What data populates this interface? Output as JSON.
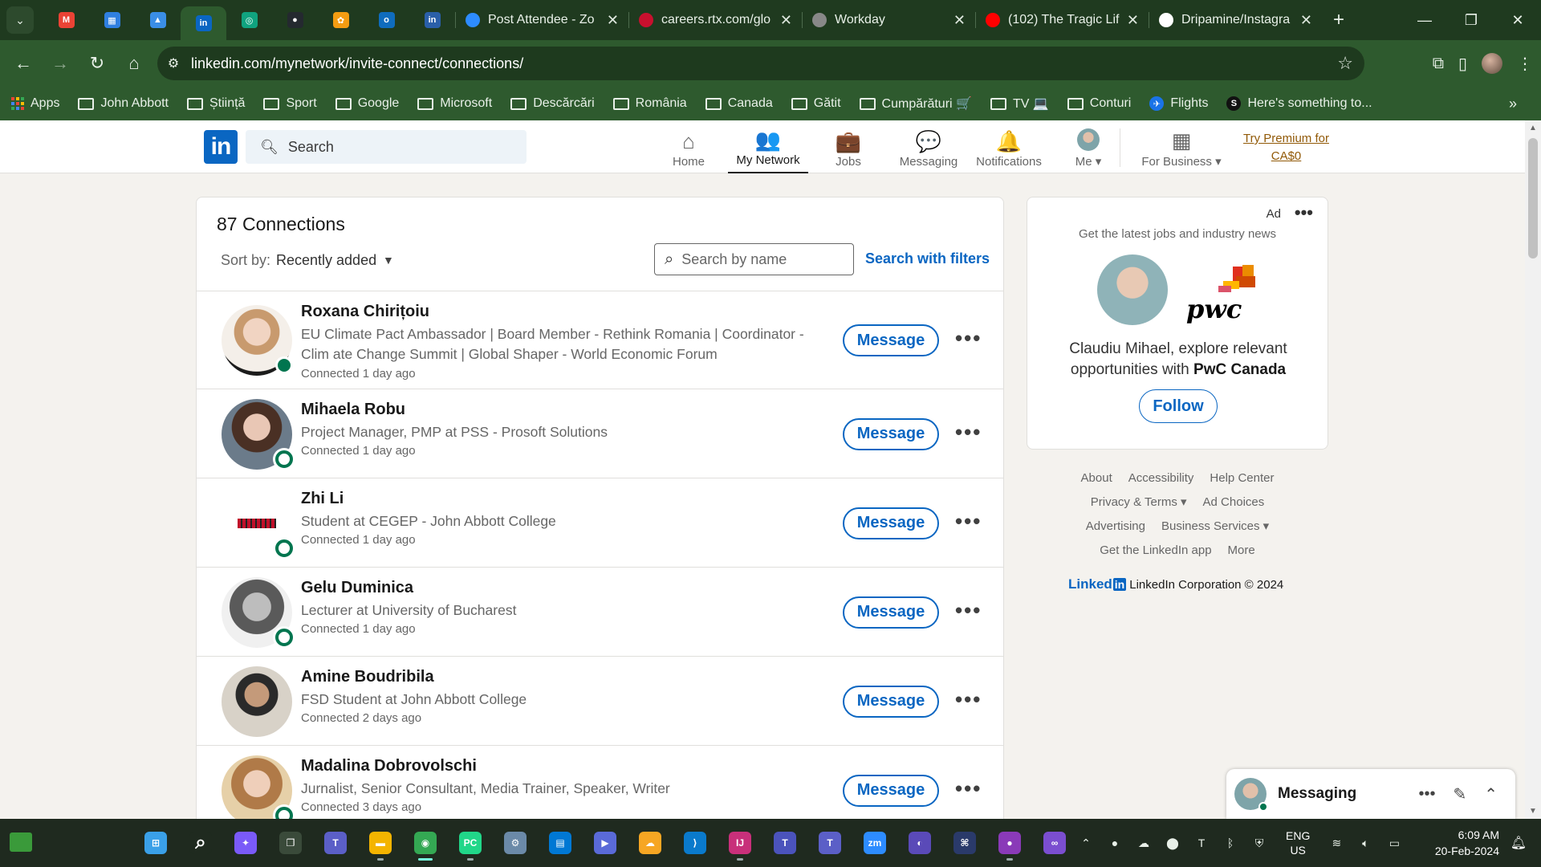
{
  "browser": {
    "tabs": [
      {
        "title": "Post Attendee - Zo",
        "icon": "zoom-icon",
        "color": "#2d8cff"
      },
      {
        "title": "careers.rtx.com/glo",
        "icon": "rtx-icon",
        "color": "#c8102e"
      },
      {
        "title": "Workday",
        "icon": "workday-icon",
        "color": "#888888"
      },
      {
        "title": "(102) The Tragic Lif",
        "icon": "youtube-icon",
        "color": "#ff0000"
      },
      {
        "title": "Dripamine/Instagra",
        "icon": "github-icon",
        "color": "#ffffff"
      }
    ],
    "pinned_tabs": [
      {
        "icon": "gmail-icon",
        "color": "#ea4335",
        "glyph": "M"
      },
      {
        "icon": "windows-icon",
        "color": "#2f7fe0",
        "glyph": "▦"
      },
      {
        "icon": "azure-icon",
        "color": "#3a8ee6",
        "glyph": "▲"
      },
      {
        "icon": "linkedin-icon",
        "color": "#0a66c2",
        "glyph": "in"
      },
      {
        "icon": "chatgpt-icon",
        "color": "#10a37f",
        "glyph": "◎"
      },
      {
        "icon": "github-icon",
        "color": "#24292f",
        "glyph": "●"
      },
      {
        "icon": "gear-orange-icon",
        "color": "#f39c12",
        "glyph": "✿"
      },
      {
        "icon": "outlook-icon",
        "color": "#0f6cbd",
        "glyph": "o"
      },
      {
        "icon": "indeed-icon",
        "color": "#2a5fa8",
        "glyph": "in"
      }
    ],
    "url": "linkedin.com/mynetwork/invite-connect/connections/",
    "bookmarks": [
      {
        "label": "Apps",
        "type": "apps"
      },
      {
        "label": "John Abbott",
        "type": "folder"
      },
      {
        "label": "Știință",
        "type": "folder"
      },
      {
        "label": "Sport",
        "type": "folder"
      },
      {
        "label": "Google",
        "type": "folder"
      },
      {
        "label": "Microsoft",
        "type": "folder"
      },
      {
        "label": "Descărcări",
        "type": "folder"
      },
      {
        "label": "România",
        "type": "folder"
      },
      {
        "label": "Canada",
        "type": "folder"
      },
      {
        "label": "Gătit",
        "type": "folder"
      },
      {
        "label": "Cumpărături 🛒",
        "type": "folder"
      },
      {
        "label": "TV 💻",
        "type": "folder"
      },
      {
        "label": "Conturi",
        "type": "folder"
      },
      {
        "label": "Flights",
        "type": "link"
      },
      {
        "label": "Here's something to...",
        "type": "link"
      }
    ]
  },
  "linkedin": {
    "search_placeholder": "Search",
    "nav": [
      {
        "label": "Home",
        "icon": "home-icon",
        "active": false
      },
      {
        "label": "My Network",
        "icon": "people-icon",
        "active": true
      },
      {
        "label": "Jobs",
        "icon": "briefcase-icon",
        "active": false
      },
      {
        "label": "Messaging",
        "icon": "chat-icon",
        "active": false
      },
      {
        "label": "Notifications",
        "icon": "bell-icon",
        "active": false
      },
      {
        "label": "Me ▾",
        "icon": "avatar",
        "active": false
      },
      {
        "label": "For Business ▾",
        "icon": "grid-icon",
        "active": false
      }
    ],
    "premium_text": "Try Premium for CA$0"
  },
  "connections": {
    "count_label": "87 Connections",
    "sort_label": "Sort by:",
    "sort_value": "Recently added",
    "search_placeholder": "Search by name",
    "search_filters_label": "Search with filters",
    "message_label": "Message",
    "list": [
      {
        "name": "Roxana Chirițoiu",
        "headline": "EU Climate Pact Ambassador | Board Member - Rethink Romania | Coordinator - Clim ate Change Summit | Global Shaper - World Economic Forum",
        "connected": "Connected 1 day ago",
        "status": "online"
      },
      {
        "name": "Mihaela Robu",
        "headline": "Project Manager, PMP at PSS - Prosoft Solutions",
        "connected": "Connected 1 day ago",
        "status": "ring"
      },
      {
        "name": "Zhi Li",
        "headline": "Student at CEGEP - John Abbott College",
        "connected": "Connected 1 day ago",
        "status": "ring"
      },
      {
        "name": "Gelu Duminica",
        "headline": "Lecturer at University of Bucharest",
        "connected": "Connected 1 day ago",
        "status": "ring"
      },
      {
        "name": "Amine Boudribila",
        "headline": "FSD Student at John Abbott College",
        "connected": "Connected 2 days ago",
        "status": "none"
      },
      {
        "name": "Madalina Dobrovolschi",
        "headline": "Jurnalist, Senior Consultant, Media Trainer, Speaker, Writer",
        "connected": "Connected 3 days ago",
        "status": "ring"
      }
    ]
  },
  "ad": {
    "label": "Ad",
    "tagline": "Get the latest jobs and industry news",
    "message_prefix": "Claudiu Mihael, explore relevant opportunities with ",
    "company": "PwC Canada",
    "brand_text": "pwc",
    "follow_label": "Follow"
  },
  "footer": {
    "rows": [
      [
        "About",
        "Accessibility",
        "Help Center"
      ],
      [
        "Privacy & Terms ▾",
        "Ad Choices"
      ],
      [
        "Advertising",
        "Business Services ▾"
      ],
      [
        "Get the LinkedIn app",
        "More"
      ]
    ],
    "brand_word": "Linked",
    "brand_in": "in",
    "copyright": "LinkedIn Corporation © 2024"
  },
  "messaging_dock": {
    "title": "Messaging"
  },
  "taskbar": {
    "apps": [
      {
        "icon": "start-icon",
        "color": "#3aa0e8",
        "glyph": "⊞"
      },
      {
        "icon": "search-icon",
        "color": "#1f2a1f",
        "glyph": "⌕"
      },
      {
        "icon": "copilot-icon",
        "color": "#7a5af8",
        "glyph": "✦"
      },
      {
        "icon": "task-view-icon",
        "color": "#3a4a3a",
        "glyph": "❐"
      },
      {
        "icon": "teams-chat-icon",
        "color": "#5b5fc7",
        "glyph": "T"
      },
      {
        "icon": "file-explorer-icon",
        "color": "#f4b400",
        "glyph": "▬"
      },
      {
        "icon": "chrome-icon",
        "color": "#34a853",
        "glyph": "◉"
      },
      {
        "icon": "pycharm-icon",
        "color": "#21d789",
        "glyph": "PC"
      },
      {
        "icon": "settings-icon",
        "color": "#6b8aa8",
        "glyph": "⚙"
      },
      {
        "icon": "store-icon",
        "color": "#0078d4",
        "glyph": "▤"
      },
      {
        "icon": "power-automate-icon",
        "color": "#5a6ad8",
        "glyph": "▶"
      },
      {
        "icon": "weather-icon",
        "color": "#f6a623",
        "glyph": "☁"
      },
      {
        "icon": "vscode-icon",
        "color": "#0a7acc",
        "glyph": "⟩"
      },
      {
        "icon": "intellij-icon",
        "color": "#c8307a",
        "glyph": "IJ"
      },
      {
        "icon": "teams-icon",
        "color": "#4b53bc",
        "glyph": "T"
      },
      {
        "icon": "teams-new-icon",
        "color": "#5b5fc7",
        "glyph": "T"
      },
      {
        "icon": "zoom-icon",
        "color": "#2d8cff",
        "glyph": "zm"
      },
      {
        "icon": "eclipse-icon",
        "color": "#5a4ab8",
        "glyph": "◐"
      },
      {
        "icon": "pycharm-ce-icon",
        "color": "#2a3a6a",
        "glyph": "⌘"
      },
      {
        "icon": "github-desktop-icon",
        "color": "#8a3ab8",
        "glyph": "●"
      },
      {
        "icon": "visual-studio-icon",
        "color": "#7b4ed0",
        "glyph": "∞"
      }
    ],
    "lang_top": "ENG",
    "lang_bottom": "US",
    "time": "6:09 AM",
    "date": "20-Feb-2024"
  }
}
